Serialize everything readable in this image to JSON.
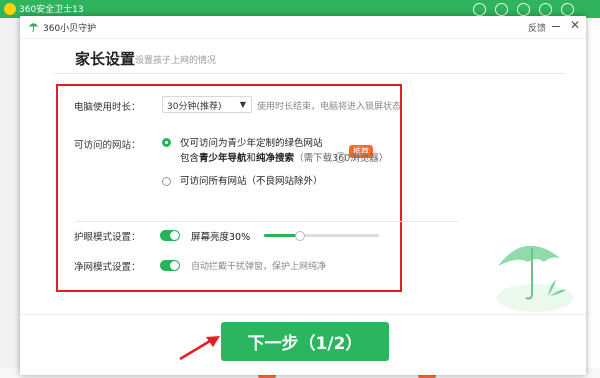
{
  "background": {
    "app_title": "360安全卫士13"
  },
  "dialog": {
    "title": "360小贝守护",
    "feedback": "反馈",
    "close": "✕"
  },
  "page": {
    "title": "家长设置",
    "subtitle": "设置孩子上网的情况"
  },
  "settings": {
    "usage_label": "电脑使用时长：",
    "usage_value": "30分钟(推荐)",
    "usage_hint": "使用时长结束，电脑将进入锁屏状态",
    "sites_label": "可访问的网站：",
    "option1": "仅可访问为青少年定制的绿色网站",
    "option1_tag": "推荐",
    "option1_help": "?",
    "option1_sub_prefix": "包含",
    "option1_sub_bold1": "青少年导航",
    "option1_sub_mid": "和",
    "option1_sub_bold2": "纯净搜索",
    "option1_sub_note": "（需下载360浏览器）",
    "option2": "可访问所有网站（不良网站除外）",
    "eye_label": "护眼模式设置：",
    "eye_brightness": "屏幕亮度30%",
    "eye_brightness_value": 0.3,
    "net_label": "净网模式设置：",
    "net_desc": "自动拦截干扰弹窗，保护上网纯净"
  },
  "next_button": "下一步（1/2）",
  "colors": {
    "accent": "#26b35a",
    "highlight_border": "#e02020",
    "tag": "#ff6a2b"
  },
  "icons": [
    "umbrella-icon",
    "chevron-down-icon",
    "help-icon",
    "close-icon",
    "minimize-icon"
  ]
}
